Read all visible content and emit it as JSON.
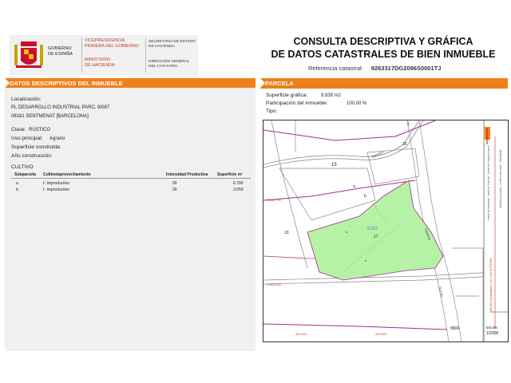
{
  "header": {
    "gob_espana": [
      "GOBIERNO",
      "DE ESPAÑA"
    ],
    "vicepresidencia": [
      "VICEPRESIDENCIA",
      "PRIMERA DEL GOBIERNO"
    ],
    "ministerio": [
      "MINISTERIO",
      "DE HACIENDA"
    ],
    "secretaria": [
      "SECRETARÍA DE ESTADO",
      "DE HACIENDA"
    ],
    "direccion": [
      "DIRECCIÓN GENERAL",
      "DEL CATASTRO"
    ],
    "title_line1": "CONSULTA DESCRIPTIVA Y GRÁFICA",
    "title_line2": "DE DATOS CATASTRALES DE BIEN INMUEBLE",
    "ref_label": "Referencia catastral:",
    "ref_value": "9263317DG2096S0001TJ"
  },
  "left": {
    "bar_title": "DATOS DESCRIPTIVOS DEL INMUEBLE",
    "localizacion_label": "Localización:",
    "localizacion_line1": "PL DESARROLLO INDUSTRIAL  PARC. 8/087",
    "localizacion_line2": "08181 SENTMENAT [BARCELONA]",
    "clase_label": "Clase:",
    "clase_value": "RÚSTICO",
    "uso_label": "Uso principal:",
    "uso_value": "Agrario",
    "superficie_label": "Superficie construida:",
    "anio_label": "Año construcción:",
    "cultivo_title": "CULTIVO",
    "cultivo_headers": [
      "Subparcela",
      "Cultivo/aprovechamiento",
      "Intensidad Productiva",
      "Superficie m²"
    ],
    "cultivo_rows": [
      [
        "a",
        "I- Improductivo",
        "00",
        "6.780"
      ],
      [
        "b",
        "I- Improductivo",
        "00",
        "3.059"
      ]
    ]
  },
  "right": {
    "bar_title": "PARCELA",
    "sup_grafica_label": "Superficie gráfica:",
    "sup_grafica_value": "9.839 m2",
    "participacion_label": "Participación del inmueble:",
    "participacion_value": "100,00 %",
    "tipo_label": "Tipo:"
  },
  "map": {
    "parcel_labels": [
      "15",
      "16",
      "10",
      "17",
      "9263",
      "a",
      "b",
      "1",
      "9806"
    ],
    "road_labels": [
      "Camino",
      "Camino",
      "N-1?0"
    ],
    "coord_labels": [
      "9.869.700",
      "9.869.200",
      "429.200",
      "429.800"
    ],
    "scale_label": "Escala:",
    "scale_value": "1/2000",
    "legend_items": [
      "Límite de Manzana",
      "Límite de Parcela",
      "Límite de Construcciones",
      "Mobiliario y aceras",
      "Límite zona verde",
      "Hidrografía"
    ],
    "legend_coords": "425,400 Coordenadas U.T.M. Huso 31 ETRS89",
    "colors": {
      "parcel_fill": "#b6f2a6",
      "parcel_line": "#a0308a",
      "orange": "#ef7f1a"
    }
  }
}
